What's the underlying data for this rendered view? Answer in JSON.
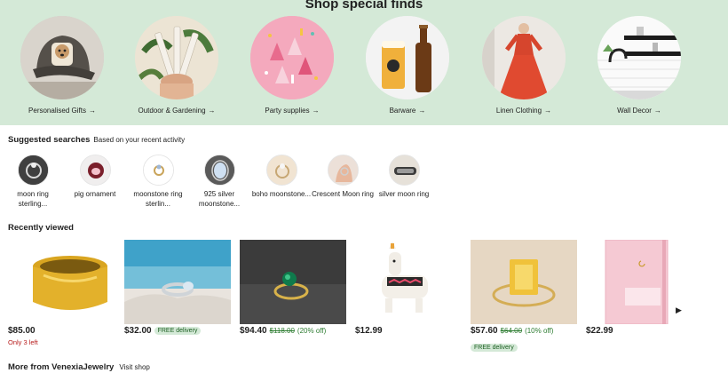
{
  "special_finds": {
    "title": "Shop special finds",
    "items": [
      {
        "label": "Personalised Gifts",
        "arrow": "→",
        "icon": "cap-image"
      },
      {
        "label": "Outdoor & Gardening",
        "arrow": "→",
        "icon": "plant-image"
      },
      {
        "label": "Party supplies",
        "arrow": "→",
        "icon": "party-image"
      },
      {
        "label": "Barware",
        "arrow": "→",
        "icon": "beer-image"
      },
      {
        "label": "Linen Clothing",
        "arrow": "→",
        "icon": "dress-image"
      },
      {
        "label": "Wall Decor",
        "arrow": "→",
        "icon": "kitchen-image"
      }
    ]
  },
  "suggested": {
    "title": "Suggested searches",
    "subtitle": "Based on your recent activity",
    "items": [
      {
        "label": "moon ring sterling..."
      },
      {
        "label": "pig ornament"
      },
      {
        "label": "moonstone ring sterlin..."
      },
      {
        "label": "925 silver moonstone..."
      },
      {
        "label": "boho moonstone..."
      },
      {
        "label": "Crescent Moon ring"
      },
      {
        "label": "silver moon ring"
      }
    ]
  },
  "recently_viewed": {
    "title": "Recently viewed",
    "next_icon": "▶",
    "items": [
      {
        "price": "$85.00",
        "stock": "Only 3 left"
      },
      {
        "price": "$32.00",
        "badge": "FREE delivery"
      },
      {
        "price": "$94.40",
        "old_price": "$118.00",
        "discount": "(20% off)"
      },
      {
        "price": "$12.99"
      },
      {
        "price": "$57.60",
        "old_price": "$64.00",
        "discount": "(10% off)",
        "badge": "FREE delivery"
      },
      {
        "price": "$22.99"
      }
    ]
  },
  "more_from": {
    "title": "More from VenexiaJewelry",
    "link": "Visit shop"
  },
  "colors": {
    "band": "#d4e9d7",
    "discount_green": "#2e7d32",
    "stock_red": "#b71c1c"
  }
}
